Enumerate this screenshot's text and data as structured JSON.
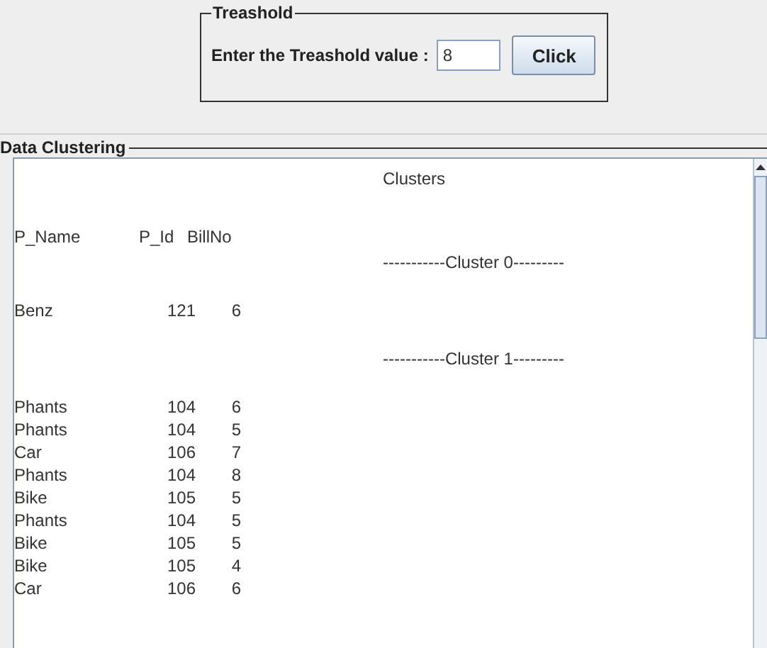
{
  "threshold_panel": {
    "title": "Treashold",
    "label": "Enter the Treashold value :",
    "value": "8",
    "button": "Click"
  },
  "clustering_panel": {
    "title": "Data Clustering",
    "lines": [
      {
        "kind": "heading",
        "text": "Clusters"
      },
      {
        "kind": "header",
        "cells": [
          "P_Name",
          "P_Id",
          "BillNo"
        ]
      },
      {
        "kind": "cluster",
        "text": "-----------Cluster 0---------"
      },
      {
        "kind": "row",
        "cells": [
          "Benz",
          "121",
          "6"
        ]
      },
      {
        "kind": "cluster",
        "text": "-----------Cluster 1---------"
      },
      {
        "kind": "row",
        "cells": [
          "Phants",
          "104",
          "6"
        ]
      },
      {
        "kind": "row",
        "cells": [
          "Phants",
          "104",
          "5"
        ]
      },
      {
        "kind": "row",
        "cells": [
          "Car",
          "106",
          "7"
        ]
      },
      {
        "kind": "row",
        "cells": [
          "Phants",
          "104",
          "8"
        ]
      },
      {
        "kind": "row",
        "cells": [
          "Bike",
          "105",
          "5"
        ]
      },
      {
        "kind": "row",
        "cells": [
          "Phants",
          "104",
          "5"
        ]
      },
      {
        "kind": "row",
        "cells": [
          "Bike",
          "105",
          "5"
        ]
      },
      {
        "kind": "row",
        "cells": [
          "Bike",
          "105",
          "4"
        ]
      },
      {
        "kind": "row",
        "cells": [
          "Car",
          "106",
          "6"
        ]
      }
    ]
  }
}
